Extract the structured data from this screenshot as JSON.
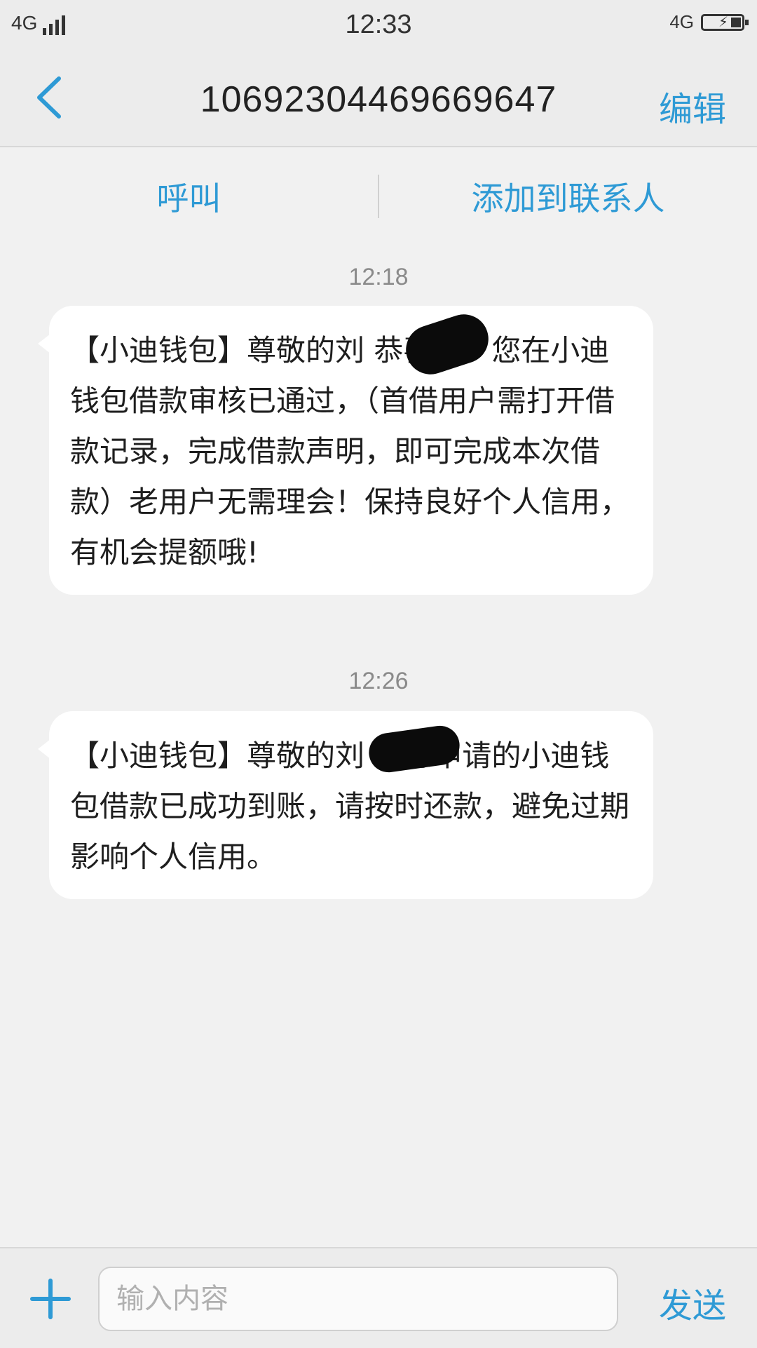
{
  "status_bar": {
    "network_left": "4G",
    "time": "12:33",
    "network_right": "4G"
  },
  "header": {
    "title": "1069230446966964 7",
    "edit_label": "编辑"
  },
  "actions": {
    "call_label": "呼叫",
    "add_contact_label": "添加到联系人"
  },
  "messages": [
    {
      "time": "12:18",
      "text": "【小迪钱包】尊敬的刘  恭喜您！您在小迪钱包借款审核已通过，（首借用户需打开借款记录，完成借款声明，即可完成本次借款）老用户无需理会！保持良好个人信用，有机会提额哦!"
    },
    {
      "time": "12:26",
      "text": "【小迪钱包】尊敬的刘  ：您申请的小迪钱包借款已成功到账，请按时还款，避免过期影响个人信用。"
    }
  ],
  "composer": {
    "placeholder": "输入内容",
    "send_label": "发送"
  },
  "colors": {
    "accent": "#2e9ad5",
    "background": "#f1f1f1",
    "bubble": "#ffffff"
  }
}
